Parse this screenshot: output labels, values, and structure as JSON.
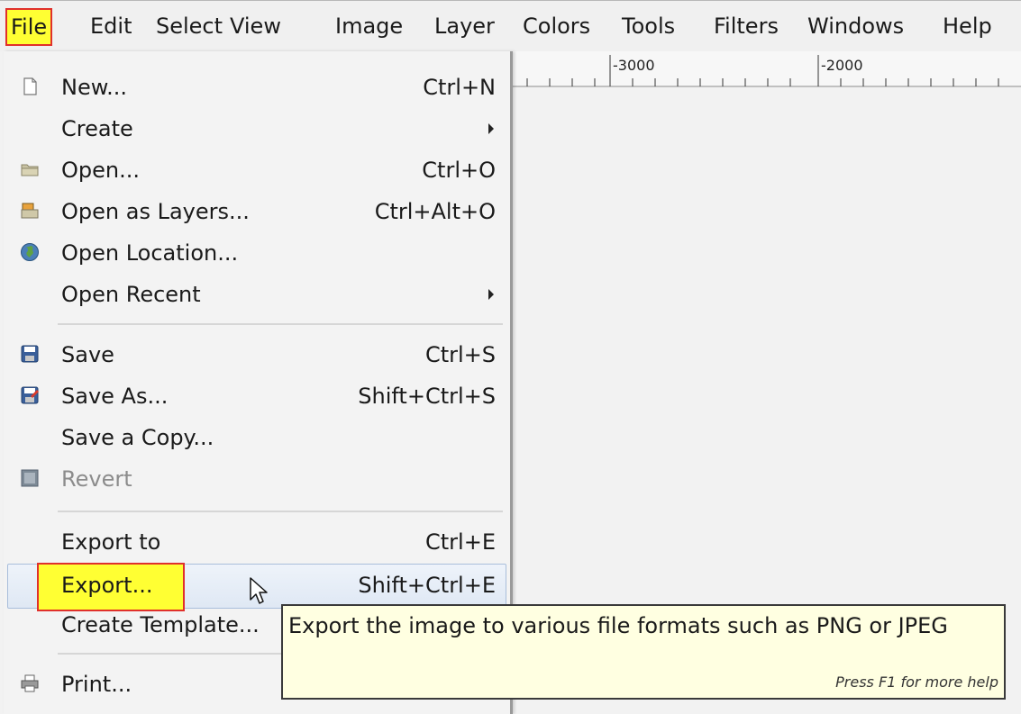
{
  "menubar": {
    "items": [
      "File",
      "Edit",
      "Select",
      "View",
      "Image",
      "Layer",
      "Colors",
      "Tools",
      "Filters",
      "Windows",
      "Help"
    ]
  },
  "ruler": {
    "labels": [
      "-3000",
      "-2000"
    ]
  },
  "file_menu": {
    "items": [
      {
        "label": "New...",
        "shortcut": "Ctrl+N",
        "icon": "new-document-icon"
      },
      {
        "label": "Create",
        "submenu": true
      },
      {
        "label": "Open...",
        "shortcut": "Ctrl+O",
        "icon": "folder-icon"
      },
      {
        "label": "Open as Layers...",
        "shortcut": "Ctrl+Alt+O",
        "icon": "open-layers-icon"
      },
      {
        "label": "Open Location...",
        "icon": "globe-icon"
      },
      {
        "label": "Open Recent",
        "submenu": true
      },
      {
        "label": "Save",
        "shortcut": "Ctrl+S",
        "icon": "save-icon"
      },
      {
        "label": "Save As...",
        "shortcut": "Shift+Ctrl+S",
        "icon": "save-as-icon"
      },
      {
        "label": "Save a Copy..."
      },
      {
        "label": "Revert",
        "icon": "revert-icon",
        "disabled": true
      },
      {
        "label": "Export to",
        "shortcut": "Ctrl+E"
      },
      {
        "label": "Export...",
        "shortcut": "Shift+Ctrl+E",
        "highlighted": true
      },
      {
        "label": "Create Template..."
      },
      {
        "label": "Print...",
        "icon": "printer-icon"
      }
    ]
  },
  "tooltip": {
    "text": "Export the image to various file formats such as PNG or JPEG",
    "help": "Press F1 for more help"
  },
  "colors": {
    "highlight_yellow": "#ffff33",
    "highlight_border": "#e0302b",
    "tooltip_bg": "#ffffe1"
  }
}
